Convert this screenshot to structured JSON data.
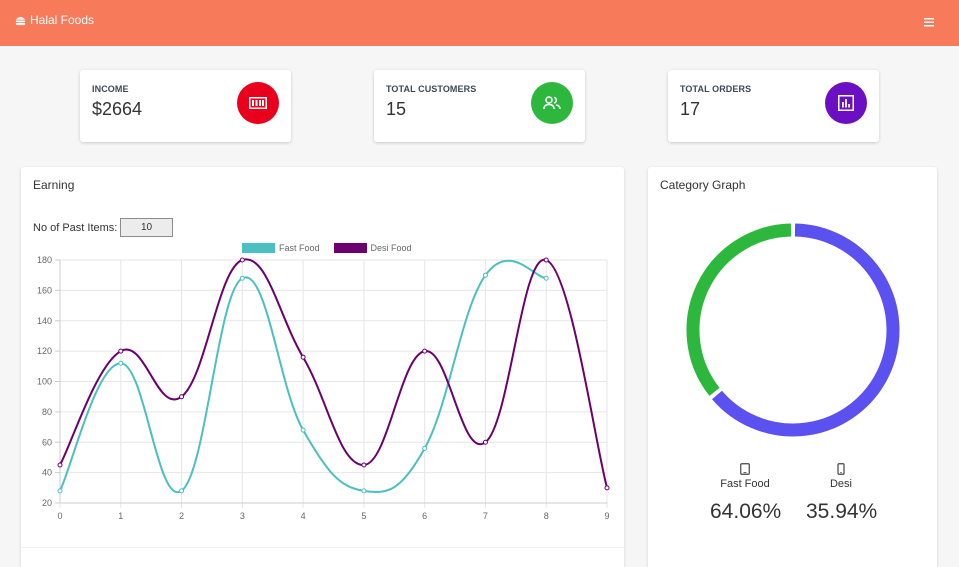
{
  "navbar": {
    "brand": "Halal Foods",
    "menu_icon": "hamburger-icon"
  },
  "stats": [
    {
      "label": "INCOME",
      "value": "$2664",
      "color": "#e8001c",
      "icon": "money-icon"
    },
    {
      "label": "TOTAL CUSTOMERS",
      "value": "15",
      "color": "#2db83d",
      "icon": "users-icon"
    },
    {
      "label": "TOTAL ORDERS",
      "value": "17",
      "color": "#6a0fc4",
      "icon": "bar-chart-icon"
    }
  ],
  "earning": {
    "title": "Earning",
    "past_items_label": "No of Past Items:",
    "past_items_value": "10"
  },
  "category": {
    "title": "Category Graph",
    "items": [
      {
        "label": "Fast Food",
        "pct": "64.06%",
        "icon": "tablet-icon"
      },
      {
        "label": "Desi",
        "pct": "35.94%",
        "icon": "phone-icon"
      }
    ]
  },
  "chart_data": [
    {
      "type": "line",
      "title": "",
      "x": [
        0,
        1,
        2,
        3,
        4,
        5,
        6,
        7,
        8,
        9
      ],
      "xlabel": "",
      "ylabel": "",
      "ylim": [
        20,
        180
      ],
      "yticks": [
        20,
        40,
        60,
        80,
        100,
        120,
        140,
        160,
        180
      ],
      "grid": true,
      "legend": "top-center",
      "series": [
        {
          "name": "Fast Food",
          "color": "#4bc0c0",
          "values": [
            28,
            112,
            28,
            168,
            68,
            28,
            56,
            170,
            168,
            null
          ]
        },
        {
          "name": "Desi Food",
          "color": "#6b006e",
          "values": [
            45,
            120,
            90,
            180,
            116,
            45,
            120,
            60,
            180,
            30
          ]
        }
      ]
    },
    {
      "type": "pie",
      "title": "",
      "legend": "bottom",
      "labels": [
        "Fast Food",
        "Desi"
      ],
      "values": [
        64.06,
        35.94
      ],
      "colors": [
        "#5b50f0",
        "#2db83d"
      ]
    }
  ]
}
